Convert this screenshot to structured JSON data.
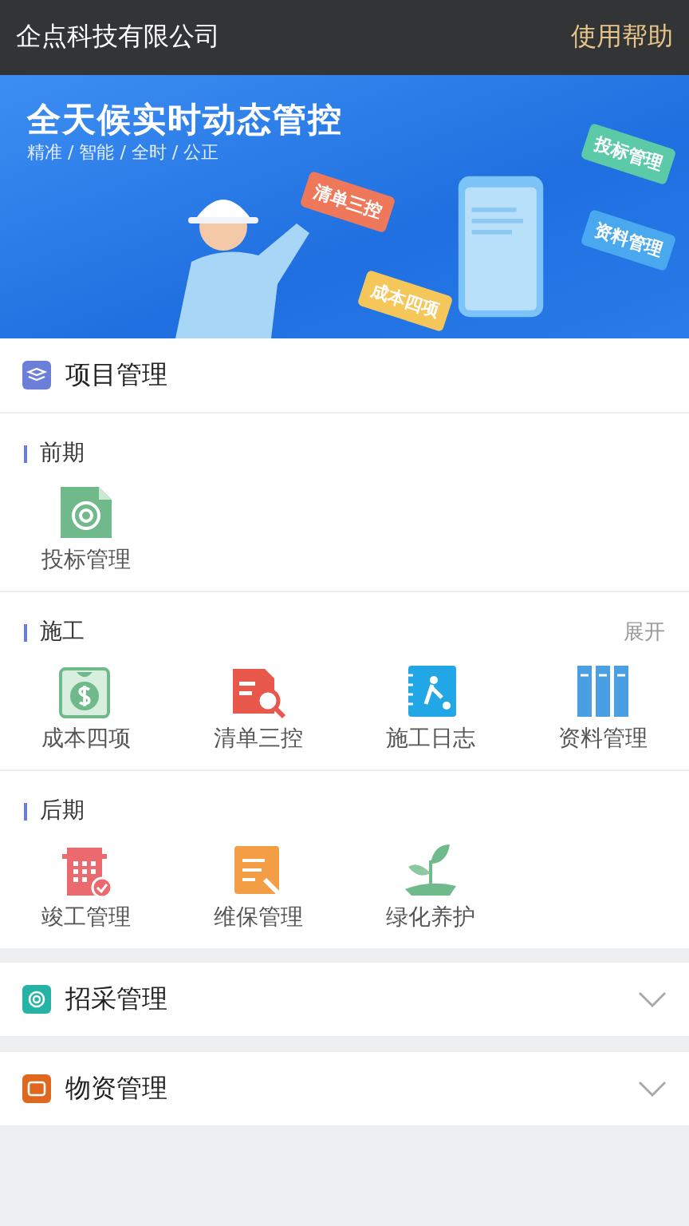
{
  "header": {
    "title": "企点科技有限公司",
    "help_link": "使用帮助"
  },
  "banner": {
    "headline": "全天候实时动态管控",
    "tagline": "精准 / 智能 / 全时 / 公正",
    "cards": [
      {
        "label": "投标管理",
        "color": "#5cc9a7"
      },
      {
        "label": "清单三控",
        "color": "#f0785a"
      },
      {
        "label": "资料管理",
        "color": "#4aa8ee"
      },
      {
        "label": "成本四项",
        "color": "#f5c65a"
      }
    ]
  },
  "sections": [
    {
      "title": "项目管理",
      "kind": "layers",
      "expanded": true,
      "groups": [
        {
          "title": "前期",
          "items": [
            {
              "label": "投标管理",
              "kind": "target"
            }
          ]
        },
        {
          "title": "施工",
          "action": "展开",
          "items": [
            {
              "label": "成本四项",
              "kind": "money"
            },
            {
              "label": "清单三控",
              "kind": "search"
            },
            {
              "label": "施工日志",
              "kind": "diary"
            },
            {
              "label": "资料管理",
              "kind": "binders"
            }
          ]
        },
        {
          "title": "后期",
          "items": [
            {
              "label": "竣工管理",
              "kind": "building"
            },
            {
              "label": "维保管理",
              "kind": "wrench"
            },
            {
              "label": "绿化养护",
              "kind": "sprout"
            }
          ]
        }
      ]
    },
    {
      "title": "招采管理",
      "kind": "target",
      "expanded": false
    },
    {
      "title": "物资管理",
      "kind": "box",
      "expanded": false
    }
  ]
}
